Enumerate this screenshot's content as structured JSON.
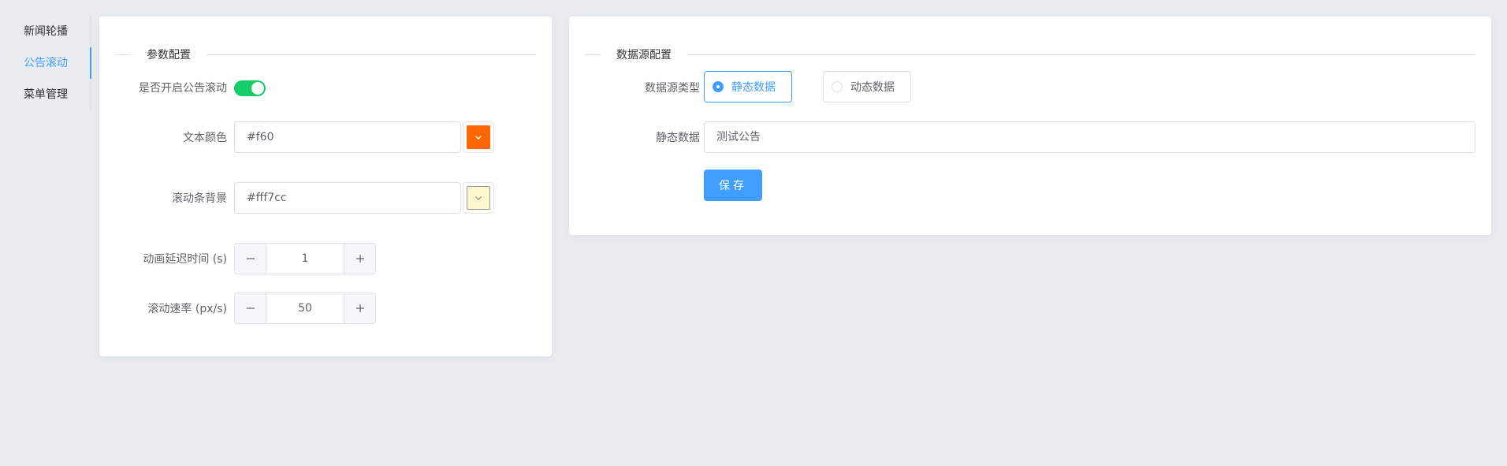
{
  "side_tabs": [
    {
      "label": "新闻轮播"
    },
    {
      "label": "公告滚动"
    },
    {
      "label": "菜单管理"
    }
  ],
  "params_panel": {
    "title": "参数配置",
    "toggle_label": "是否开启公告滚动",
    "toggle_on": true,
    "text_color_label": "文本颜色",
    "text_color_value": "#f60",
    "text_color_swatch": "#ff6600",
    "bg_label": "滚动条背景",
    "bg_value": "#fff7cc",
    "bg_swatch": "#fff7cc",
    "delay_label": "动画延迟时间 (s)",
    "delay_value": "1",
    "speed_label": "滚动速率 (px/s)",
    "speed_value": "50"
  },
  "datasource_panel": {
    "title": "数据源配置",
    "type_label": "数据源类型",
    "options": [
      {
        "label": "静态数据",
        "checked": true
      },
      {
        "label": "动态数据",
        "checked": false
      }
    ],
    "static_label": "静态数据",
    "static_value": "测试公告",
    "save_label": "保存"
  },
  "colors": {
    "accent": "#409eff",
    "switch_on": "#13ce66",
    "background": "#e9edf1"
  }
}
